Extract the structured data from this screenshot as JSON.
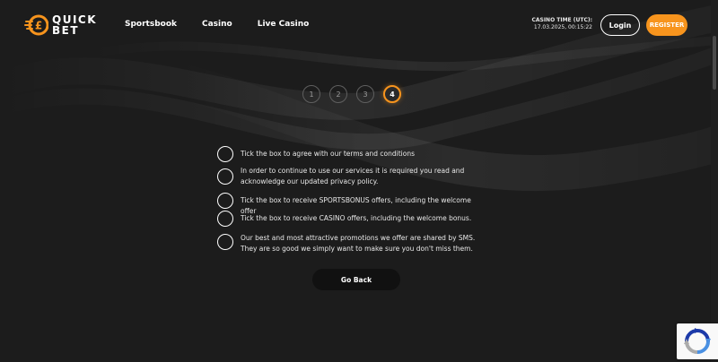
{
  "header": {
    "logo_line1": "QUICK",
    "logo_line2": "BET",
    "logo_icon": "pound-coin-icon",
    "nav": [
      {
        "label": "Sportsbook"
      },
      {
        "label": "Casino"
      },
      {
        "label": "Live Casino"
      }
    ],
    "casino_time_label": "CASINO TIME (UTC):",
    "casino_time_value": "17.03.2025, 00:15:22",
    "login_label": "Login",
    "register_label": "REGISTER"
  },
  "steps": {
    "items": [
      "1",
      "2",
      "3",
      "4"
    ],
    "active": "4"
  },
  "checklist": {
    "items": [
      {
        "text": "Tick the box to agree with our terms and conditions"
      },
      {
        "text": "In order to continue to use our services it is required you read and acknowledge our updated privacy policy."
      },
      {
        "text": "Tick the box to receive SPORTSBONUS offers, including the welcome offer"
      },
      {
        "text": "Tick the box to receive CASINO offers, including the welcome bonus."
      },
      {
        "text": "Our best and most attractive promotions we offer are shared by SMS. They are so good we simply want to make sure you don't miss them."
      }
    ]
  },
  "go_back_label": "Go Back",
  "colors": {
    "accent": "#f7941d",
    "background": "#1c1c1c"
  },
  "icons": {
    "recaptcha": "recaptcha-icon"
  }
}
